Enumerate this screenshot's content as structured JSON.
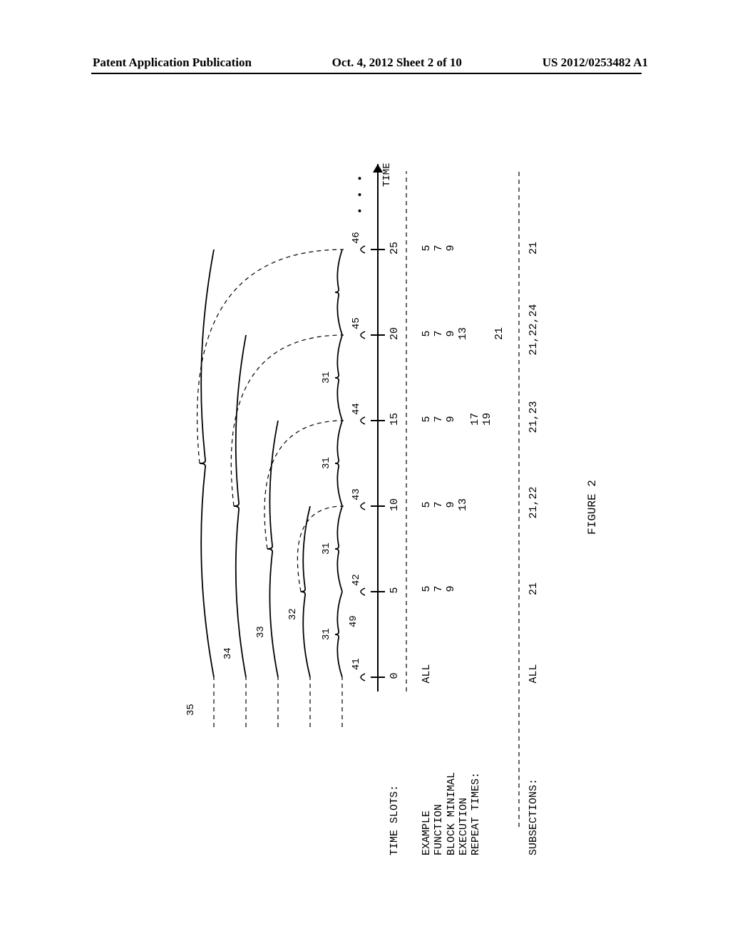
{
  "header": {
    "left": "Patent Application Publication",
    "center": "Oct. 4, 2012  Sheet 2 of 10",
    "right": "US 2012/0253482 A1"
  },
  "diagram": {
    "time_axis_label": "TIME",
    "time_slots_label": "TIME SLOTS:",
    "function_block_label": "EXAMPLE\nFUNCTION\nBLOCK MINIMAL\nEXECUTION\nREPEAT TIMES:",
    "subsections_label": "SUBSECTIONS:",
    "figure_caption": "FIGURE 2",
    "time_slots": [
      "0",
      "5",
      "10",
      "15",
      "20",
      "25"
    ],
    "function_blocks": {
      "t0": [
        "ALL"
      ],
      "t5": [
        "5",
        "7",
        "9"
      ],
      "t10": [
        "5",
        "7",
        "9",
        "13"
      ],
      "t15": [
        "5",
        "7",
        "9",
        "",
        "17",
        "19"
      ],
      "t20": [
        "5",
        "7",
        "9",
        "13",
        "",
        "",
        "21"
      ],
      "t25": [
        "5",
        "7",
        "9"
      ]
    },
    "subsections": {
      "t0": "ALL",
      "t5": "21",
      "t10": "21,22",
      "t15": "21,23",
      "t20": "21,22,24",
      "t25": "21"
    },
    "reference_numerals": {
      "brace35": "35",
      "brace34": "34",
      "brace33": "33",
      "brace32": "32",
      "brace31": "31",
      "tick41": "41",
      "tick42": "42",
      "tick43": "43",
      "tick44": "44",
      "tick45": "45",
      "tick46": "46",
      "ref49": "49",
      "dots": "• • •"
    }
  },
  "chart_data": {
    "type": "table",
    "title": "FIGURE 2 - Time Slot Execution Diagram",
    "xlabel": "TIME",
    "categories": [
      0,
      5,
      10,
      15,
      20,
      25
    ],
    "series": [
      {
        "name": "Function Block Minimal Execution Repeat Times",
        "values": [
          [
            "ALL"
          ],
          [
            5,
            7,
            9
          ],
          [
            5,
            7,
            9,
            13
          ],
          [
            5,
            7,
            9,
            17,
            19
          ],
          [
            5,
            7,
            9,
            13,
            21
          ],
          [
            5,
            7,
            9
          ]
        ]
      },
      {
        "name": "Subsections",
        "values": [
          [
            "ALL"
          ],
          [
            21
          ],
          [
            21,
            22
          ],
          [
            21,
            23
          ],
          [
            21,
            22,
            24
          ],
          [
            21
          ]
        ]
      }
    ],
    "brace_reference_numerals": [
      31,
      32,
      33,
      34,
      35
    ],
    "tick_reference_numerals": [
      41,
      42,
      43,
      44,
      45,
      46,
      49
    ]
  }
}
